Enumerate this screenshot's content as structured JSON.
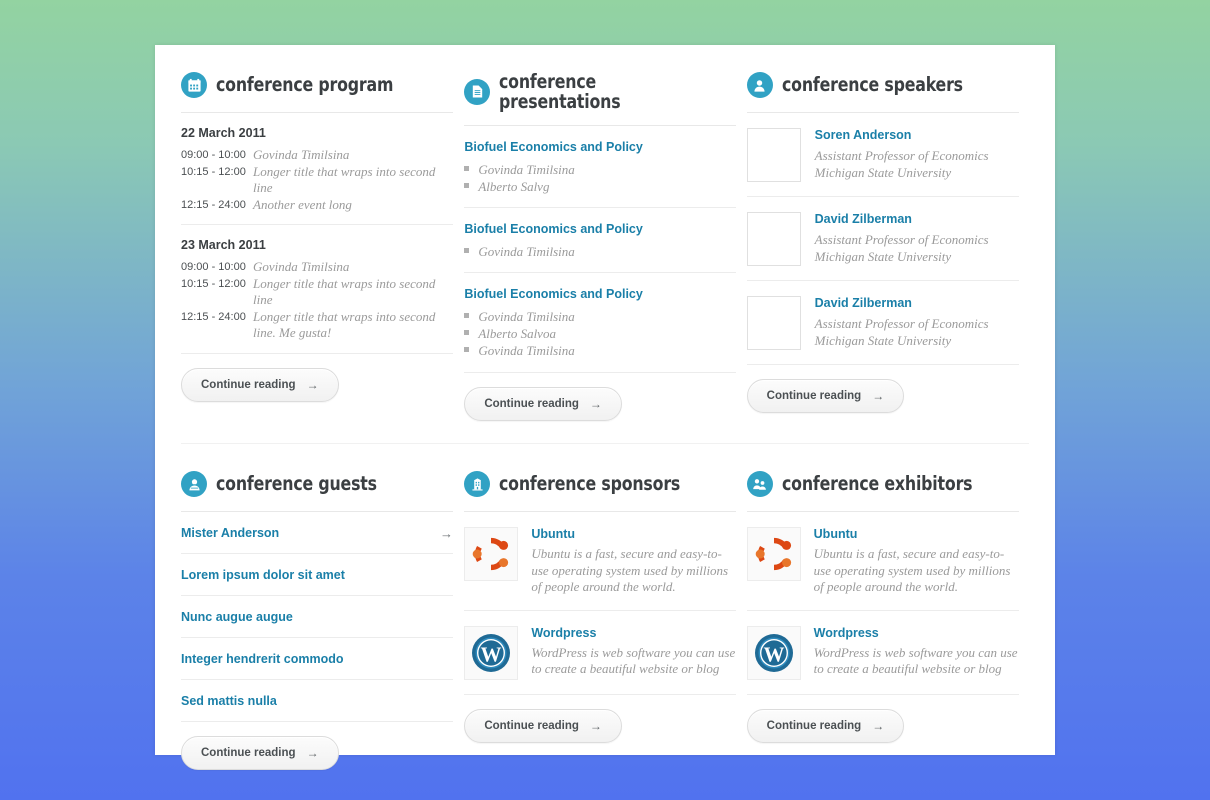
{
  "widgets": {
    "program": {
      "icon": "calendar-icon",
      "title": "conference program",
      "days": [
        {
          "date": "22 March 2011",
          "events": [
            {
              "time": "09:00 - 10:00",
              "title": "Govinda Timilsina"
            },
            {
              "time": "10:15 - 12:00",
              "title": "Longer title that wraps into second line"
            },
            {
              "time": "12:15 - 24:00",
              "title": "Another event long"
            }
          ]
        },
        {
          "date": "23 March 2011",
          "events": [
            {
              "time": "09:00 - 10:00",
              "title": "Govinda Timilsina"
            },
            {
              "time": "10:15 - 12:00",
              "title": "Longer title that wraps into second line"
            },
            {
              "time": "12:15 - 24:00",
              "title": "Longer title that wraps into second line. Me gusta!"
            }
          ]
        }
      ],
      "button": "Continue reading"
    },
    "presentations": {
      "icon": "document-icon",
      "title": "conference presentations",
      "items": [
        {
          "title": "Biofuel Economics and Policy",
          "authors": [
            "Govinda Timilsina",
            "Alberto Salvg"
          ]
        },
        {
          "title": "Biofuel Economics and Policy",
          "authors": [
            "Govinda Timilsina"
          ]
        },
        {
          "title": "Biofuel Economics and Policy",
          "authors": [
            "Govinda Timilsina",
            "Alberto Salvoa",
            "Govinda Timilsina"
          ]
        }
      ],
      "button": "Continue reading"
    },
    "speakers": {
      "icon": "user-icon",
      "title": "conference speakers",
      "items": [
        {
          "name": "Soren Anderson",
          "role": "Assistant Professor of Economics",
          "affiliation": "Michigan State University"
        },
        {
          "name": "David Zilberman",
          "role": "Assistant Professor of Economics",
          "affiliation": "Michigan State University"
        },
        {
          "name": "David Zilberman",
          "role": "Assistant Professor of Economics",
          "affiliation": "Michigan State University"
        }
      ],
      "button": "Continue reading"
    },
    "guests": {
      "icon": "guest-icon",
      "title": "conference guests",
      "items": [
        {
          "name": "Mister Anderson",
          "arrow": "→"
        },
        {
          "name": "Lorem ipsum dolor sit amet",
          "arrow": ""
        },
        {
          "name": "Nunc augue augue",
          "arrow": ""
        },
        {
          "name": "Integer hendrerit commodo",
          "arrow": ""
        },
        {
          "name": "Sed mattis nulla",
          "arrow": ""
        }
      ],
      "button": "Continue reading"
    },
    "sponsors": {
      "icon": "building-icon",
      "title": "conference sponsors",
      "items": [
        {
          "logo": "ubuntu-logo",
          "name": "Ubuntu",
          "desc": "Ubuntu is a fast, secure and easy-to-use operating system used by millions of people around the world."
        },
        {
          "logo": "wordpress-logo",
          "name": "Wordpress",
          "desc": "WordPress is web software you can use to create a beautiful website or blog"
        }
      ],
      "button": "Continue reading"
    },
    "exhibitors": {
      "icon": "users-icon",
      "title": "conference exhibitors",
      "items": [
        {
          "logo": "ubuntu-logo",
          "name": "Ubuntu",
          "desc": "Ubuntu is a fast, secure and easy-to-use operating system used by millions of people around the world."
        },
        {
          "logo": "wordpress-logo",
          "name": "Wordpress",
          "desc": "WordPress is web software you can use to create a beautiful website or blog"
        }
      ],
      "button": "Continue reading"
    }
  },
  "colors": {
    "accent_teal": "#31a2c4",
    "link_blue": "#1a7fa8",
    "heading_dark": "#3b3f42",
    "muted_italic": "#9a9a9a",
    "page_bg": "#ffffff",
    "bg_gradient_top": "#93d3a1",
    "bg_gradient_bottom": "#5172ef"
  }
}
